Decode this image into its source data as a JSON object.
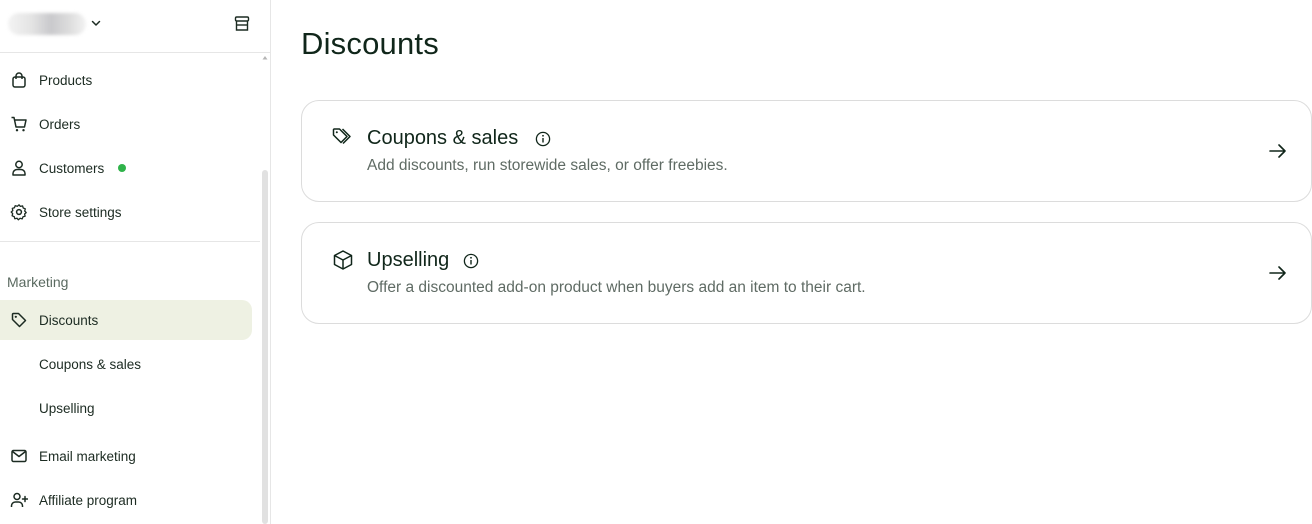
{
  "sidebar": {
    "items_top": [
      {
        "label": "Products",
        "icon": "shopping-bag-icon"
      },
      {
        "label": "Orders",
        "icon": "cart-icon"
      },
      {
        "label": "Customers",
        "icon": "person-icon",
        "badge_color": "#2fb34a"
      },
      {
        "label": "Store settings",
        "icon": "gear-icon"
      }
    ],
    "section_label": "Marketing",
    "items_marketing": [
      {
        "label": "Discounts",
        "icon": "tag-icon",
        "active": true
      },
      {
        "label": "Coupons & sales"
      },
      {
        "label": "Upselling"
      },
      {
        "label": "Email marketing",
        "icon": "mail-icon"
      },
      {
        "label": "Affiliate program",
        "icon": "person-add-icon"
      }
    ]
  },
  "main": {
    "title": "Discounts",
    "cards": [
      {
        "title": "Coupons & sales",
        "description": "Add discounts, run storewide sales, or offer freebies.",
        "icon": "tags-icon"
      },
      {
        "title": "Upselling",
        "description": "Offer a discounted add-on product when buyers add an item to their cart.",
        "icon": "box-icon"
      }
    ]
  },
  "colors": {
    "accent_active_bg": "#eef1e3",
    "text_dark": "#10261a",
    "online_dot": "#2fb34a"
  }
}
